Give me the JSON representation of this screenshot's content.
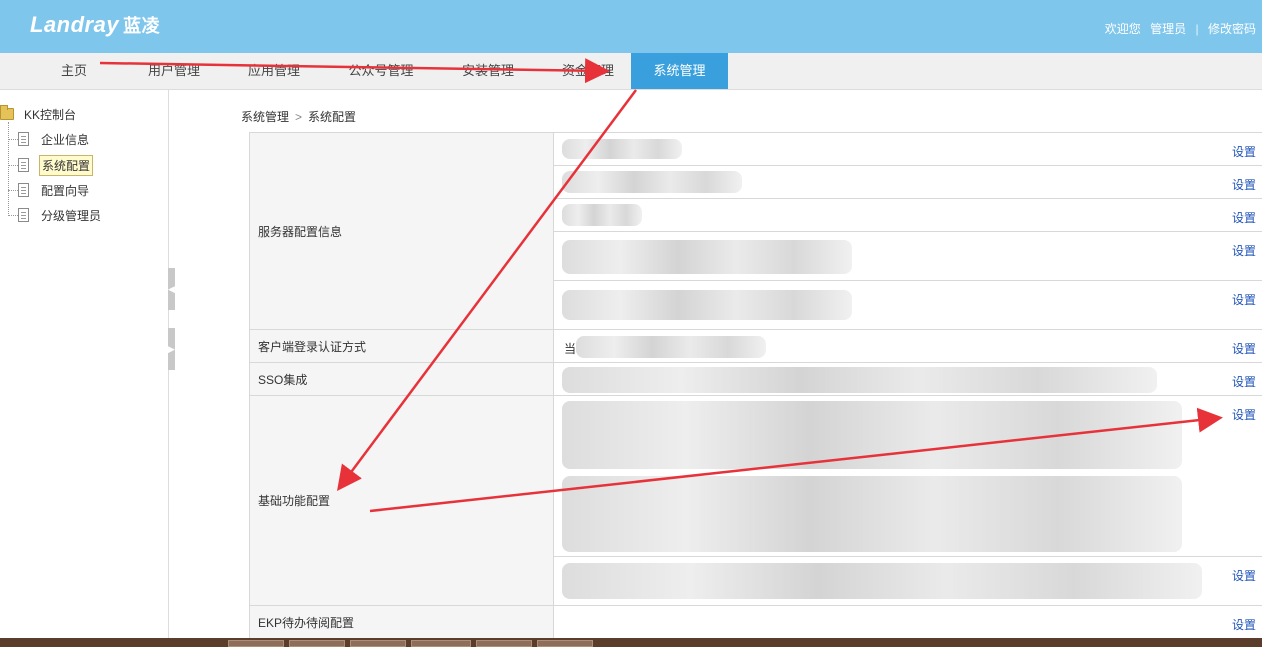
{
  "header": {
    "logo_text": "Landray",
    "logo_cn": "蓝凌",
    "welcome": "欢迎您",
    "user": "管理员",
    "separator": "|",
    "change_password": "修改密码"
  },
  "nav": {
    "items": [
      "主页",
      "用户管理",
      "应用管理",
      "公众号管理",
      "安装管理",
      "资金管理",
      "系统管理"
    ],
    "active": "系统管理"
  },
  "sidebar": {
    "root": "KK控制台",
    "items": [
      "企业信息",
      "系统配置",
      "配置向导",
      "分级管理员"
    ],
    "selected": "系统配置"
  },
  "breadcrumb": {
    "parent": "系统管理",
    "separator": ">",
    "current": "系统配置"
  },
  "config": {
    "set_label": "设置",
    "rows": [
      {
        "label": "服务器配置信息"
      },
      {
        "label": "客户端登录认证方式",
        "value_prefix": "当"
      },
      {
        "label": "SSO集成"
      },
      {
        "label": "基础功能配置"
      },
      {
        "label": "EKP待办待阅配置"
      }
    ]
  },
  "annotation_color": "#e8323a"
}
